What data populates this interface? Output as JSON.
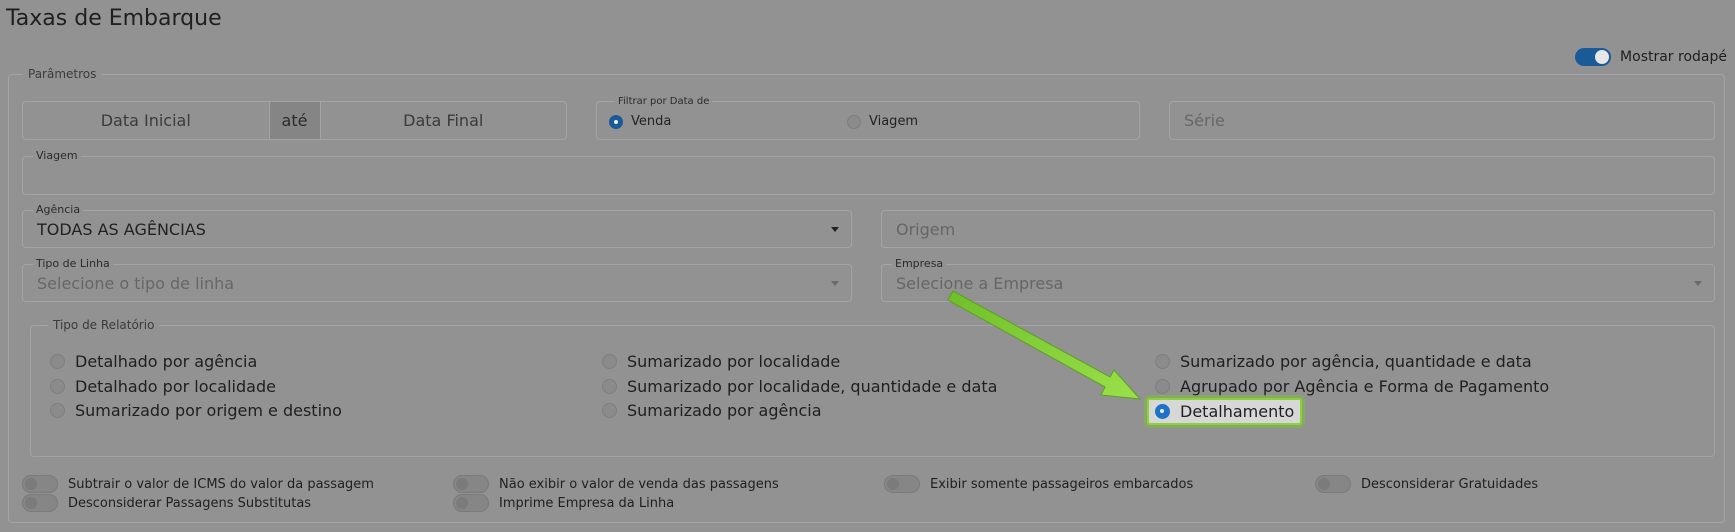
{
  "title": "Taxas de Embarque",
  "mostrar_rodape": {
    "label": "Mostrar rodapé",
    "on": true
  },
  "parametros_legend": "Parâmetros",
  "data": {
    "inicial": "Data Inicial",
    "ate": "até",
    "final": "Data Final"
  },
  "filtro": {
    "label": "Filtrar por Data de",
    "options": [
      {
        "label": "Venda",
        "checked": true
      },
      {
        "label": "Viagem",
        "checked": false
      }
    ]
  },
  "serie": {
    "placeholder": "Série"
  },
  "viagem": {
    "label": "Viagem",
    "value": ""
  },
  "agencia": {
    "label": "Agência",
    "value": "TODAS AS AGÊNCIAS"
  },
  "origem": {
    "placeholder": "Origem"
  },
  "tipo_linha": {
    "label": "Tipo de Linha",
    "placeholder": "Selecione o tipo de linha"
  },
  "empresa": {
    "label": "Empresa",
    "placeholder": "Selecione a Empresa"
  },
  "tipo_relatorio": {
    "legend": "Tipo de Relatório",
    "options": [
      "Detalhado por agência",
      "Detalhado por localidade",
      "Sumarizado por origem e destino",
      "Sumarizado por localidade",
      "Sumarizado por localidade, quantidade e data",
      "Sumarizado por agência",
      "Sumarizado por agência, quantidade e data",
      "Agrupado por Agência e Forma de Pagamento",
      "Detalhamento"
    ],
    "selected": "Detalhamento"
  },
  "toggles": [
    "Subtrair o valor de ICMS do valor da passagem",
    "Desconsiderar Passagens Substitutas",
    "Não exibir o valor de venda das passagens",
    "Imprime Empresa da Linha",
    "Exibir somente passageiros embarcados",
    "Desconsiderar Gratuidades"
  ],
  "colors": {
    "accent": "#1a5a96",
    "highlight": "#8ed23a",
    "overlay_bg": "#929292"
  }
}
